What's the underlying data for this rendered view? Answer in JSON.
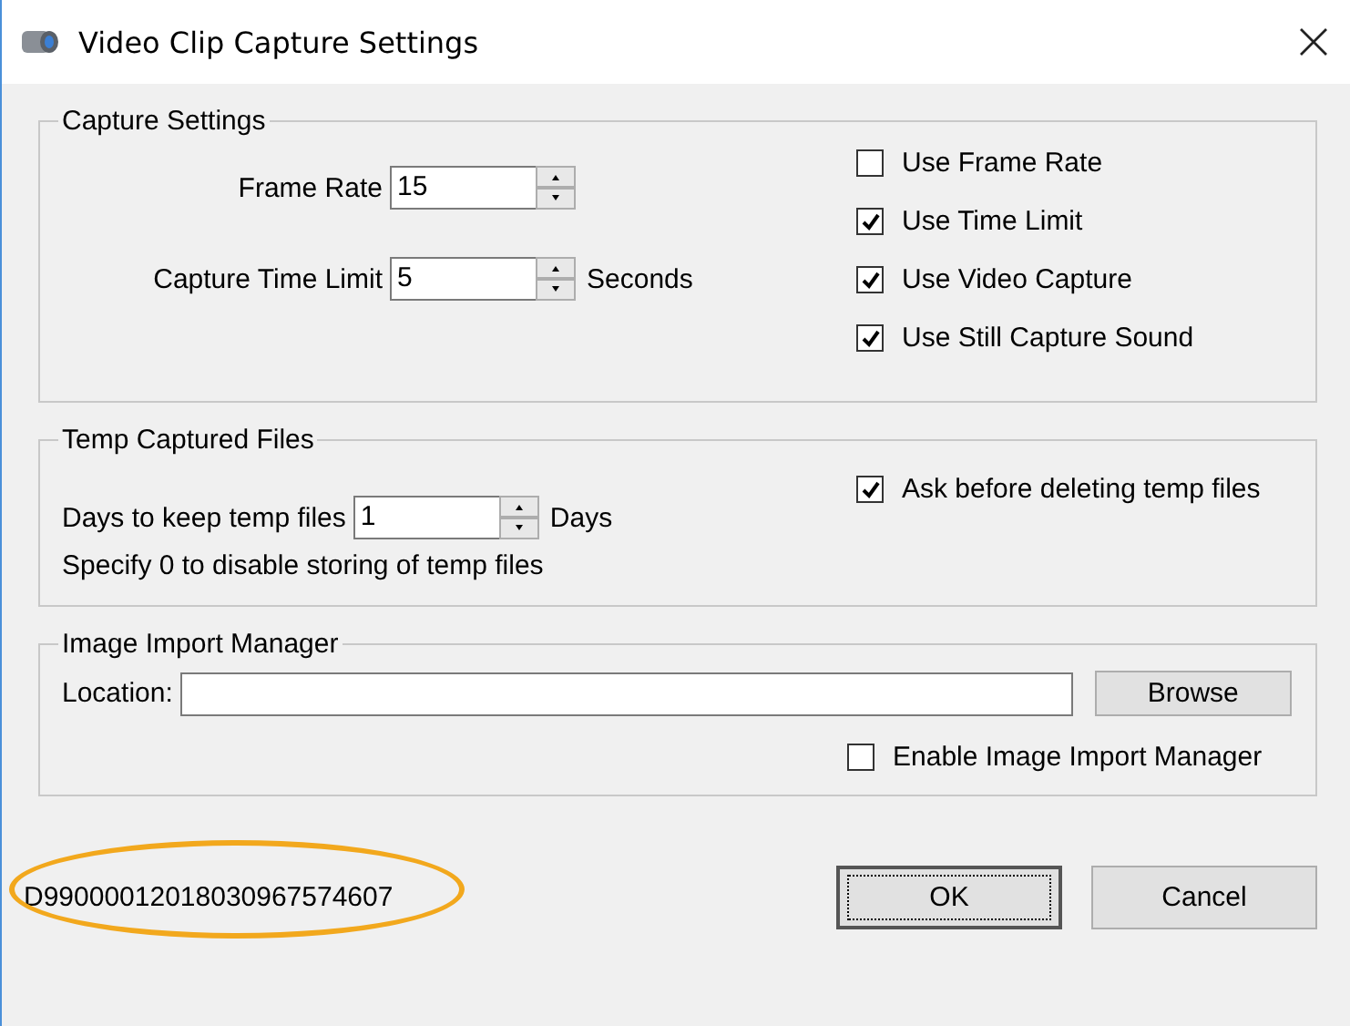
{
  "window": {
    "title": "Video Clip Capture Settings"
  },
  "capture_settings": {
    "title": "Capture Settings",
    "fields": [
      {
        "label": "Frame Rate",
        "value": "15"
      },
      {
        "label": "Capture Time Limit",
        "value": "5",
        "unit": "Seconds"
      }
    ],
    "options": [
      {
        "label": "Use Frame Rate",
        "checked": false
      },
      {
        "label": "Use Time Limit",
        "checked": true
      },
      {
        "label": "Use Video Capture",
        "checked": true
      },
      {
        "label": "Use Still Capture Sound",
        "checked": true
      }
    ]
  },
  "temp_files": {
    "title": "Temp Captured Files",
    "field": {
      "label": "Days to keep temp files",
      "value": "1",
      "unit": "Days"
    },
    "hint": "Specify 0 to disable storing of temp files",
    "options": [
      {
        "label": "Ask before deleting temp files",
        "checked": true
      }
    ]
  },
  "import_manager": {
    "title": "Image Import Manager",
    "location_label": "Location:",
    "browse": "Browse",
    "options": [
      {
        "label": "Enable Image Import Manager",
        "checked": false
      }
    ]
  },
  "footer": {
    "serial": "D99000012018030967574607",
    "highlighted": true,
    "buttons": [
      {
        "label": "OK",
        "default": true
      },
      {
        "label": "Cancel",
        "default": false
      }
    ]
  }
}
